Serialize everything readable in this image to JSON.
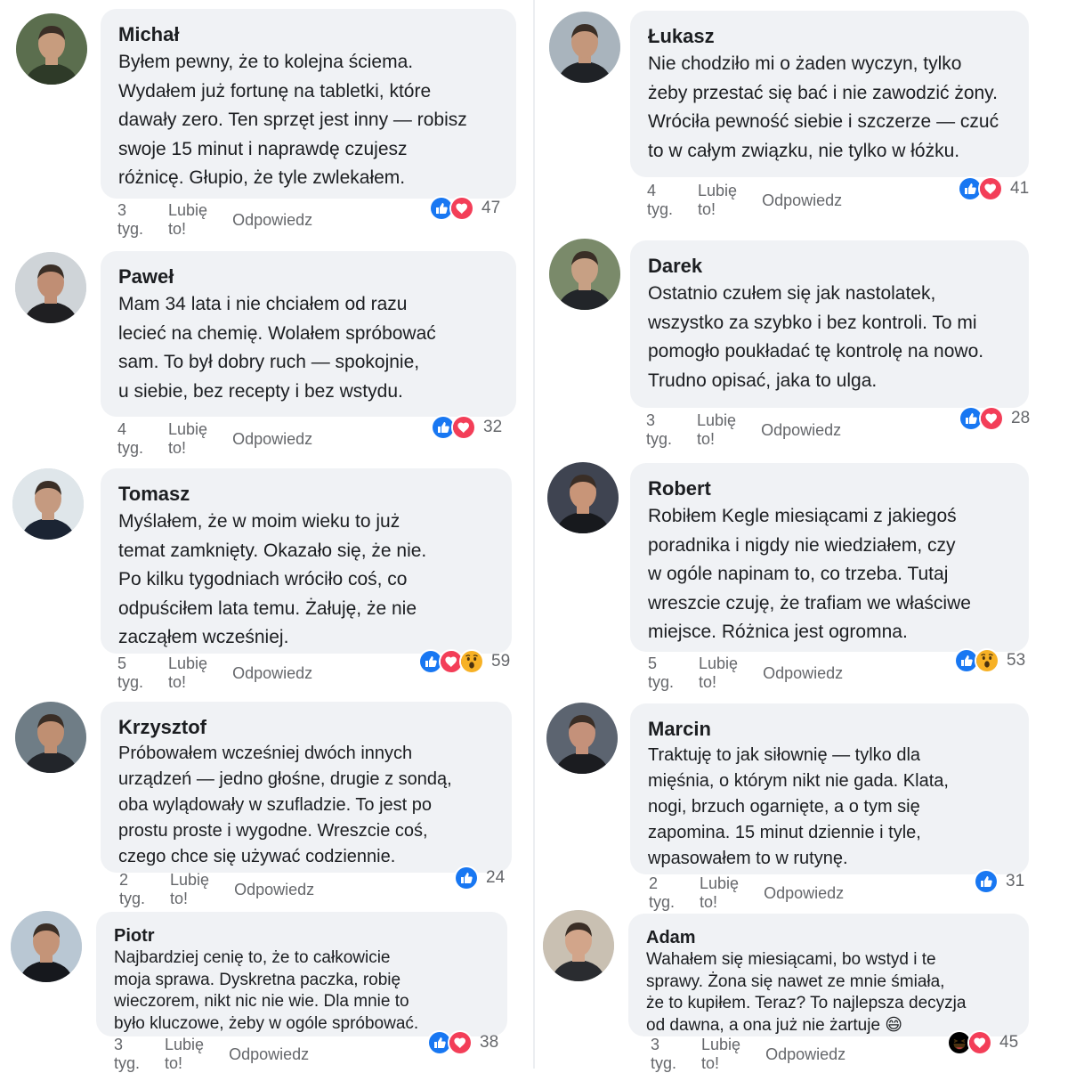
{
  "comments": [
    {
      "name": "Michał",
      "text": "Byłem pewny, że to kolejna ściema.\nWydałem już fortunę na tabletki, które\ndawały zero. Ten sprzęt jest inny — robisz\nswoje 15 minut i naprawdę czujesz\nróżnicę. Głupio, że tyle zwlekałem.",
      "time": "3 tyg.",
      "like": "Lubię to!",
      "reply": "Odpowiedz",
      "reactions": [
        "like",
        "love"
      ],
      "count": "47"
    },
    {
      "name": "Paweł",
      "text": "Mam 34 lata i nie chciałem od razu\nlecieć na chemię. Wolałem spróbować\nsam. To był dobry ruch — spokojnie,\nu siebie, bez recepty i bez wstydu.",
      "time": "4 tyg.",
      "like": "Lubię to!",
      "reply": "Odpowiedz",
      "reactions": [
        "like",
        "love"
      ],
      "count": "32"
    },
    {
      "name": "Tomasz",
      "text": "Myślałem, że w moim wieku to już\ntemat zamknięty. Okazało się, że nie.\nPo kilku tygodniach wróciło coś, co\nodpuściłem lata temu. Żałuję, że nie\nzacząłem wcześniej.",
      "time": "5 tyg.",
      "like": "Lubię to!",
      "reply": "Odpowiedz",
      "reactions": [
        "like",
        "love",
        "wow"
      ],
      "count": "59"
    },
    {
      "name": "Krzysztof",
      "text": "Próbowałem wcześniej dwóch innych\nurządzeń — jedno głośne, drugie z sondą,\noba wylądowały w szufladzie. To jest po\nprostu proste i wygodne. Wreszcie coś,\nczego chce się używać codziennie.",
      "time": "2 tyg.",
      "like": "Lubię to!",
      "reply": "Odpowiedz",
      "reactions": [
        "like"
      ],
      "count": "24"
    },
    {
      "name": "Piotr",
      "text": "Najbardziej cenię to, że to całkowicie\nmoja sprawa. Dyskretna paczka, robię\nwieczorem, nikt nic nie wie. Dla mnie to\nbyło kluczowe, żeby w ogóle spróbować.",
      "time": "3 tyg.",
      "like": "Lubię to!",
      "reply": "Odpowiedz",
      "reactions": [
        "like",
        "love"
      ],
      "count": "38"
    },
    {
      "name": "Łukasz",
      "text": "Nie chodziło mi o żaden wyczyn, tylko\nżeby przestać się bać i nie zawodzić żony.\nWróciła pewność siebie i szczerze — czuć\nto w całym związku, nie tylko w łóżku.",
      "time": "4 tyg.",
      "like": "Lubię to!",
      "reply": "Odpowiedz",
      "reactions": [
        "like",
        "love"
      ],
      "count": "41"
    },
    {
      "name": "Darek",
      "text": "Ostatnio czułem się jak nastolatek,\nwszystko za szybko i bez kontroli. To mi\npomogło poukładać tę kontrolę na nowo.\nTrudno opisać, jaka to ulga.",
      "time": "3 tyg.",
      "like": "Lubię to!",
      "reply": "Odpowiedz",
      "reactions": [
        "like",
        "love"
      ],
      "count": "28"
    },
    {
      "name": "Robert",
      "text": "Robiłem Kegle miesiącami z jakiegoś\nporadnika i nigdy nie wiedziałem, czy\nw ogóle napinam to, co trzeba. Tutaj\nwreszcie czuję, że trafiam we właściwe\nmiejsce. Różnica jest ogromna.",
      "time": "5 tyg.",
      "like": "Lubię to!",
      "reply": "Odpowiedz",
      "reactions": [
        "like",
        "wow"
      ],
      "count": "53"
    },
    {
      "name": "Marcin",
      "text": "Traktuję to jak siłownię — tylko dla\nmięśnia, o którym nikt nie gada. Klata,\nnogi, brzuch ogarnięte, a o tym się\nzapomina. 15 minut dziennie i tyle,\nwpasowałem to w rutynę.",
      "time": "2 tyg.",
      "like": "Lubię to!",
      "reply": "Odpowiedz",
      "reactions": [
        "like"
      ],
      "count": "31"
    },
    {
      "name": "Adam",
      "text": "Wahałem się miesiącami, bo wstyd i te\nsprawy. Żona się nawet ze mnie śmiała,\nże to kupiłem. Teraz? To najlepsza decyzja\nod dawna, a ona już nie żartuje 😄",
      "time": "3 tyg.",
      "like": "Lubię to!",
      "reply": "Odpowiedz",
      "reactions": [
        "haha",
        "love"
      ],
      "count": "45"
    }
  ],
  "colors": {
    "like": "#1877f2",
    "love": "#f33e58",
    "wow": "#f7b125",
    "bubble": "#f0f2f5",
    "meta": "#65676b"
  },
  "icons": {
    "like": "thumbs-up-icon",
    "love": "heart-icon",
    "wow": "wow-face-icon",
    "haha": "haha-face-icon"
  }
}
